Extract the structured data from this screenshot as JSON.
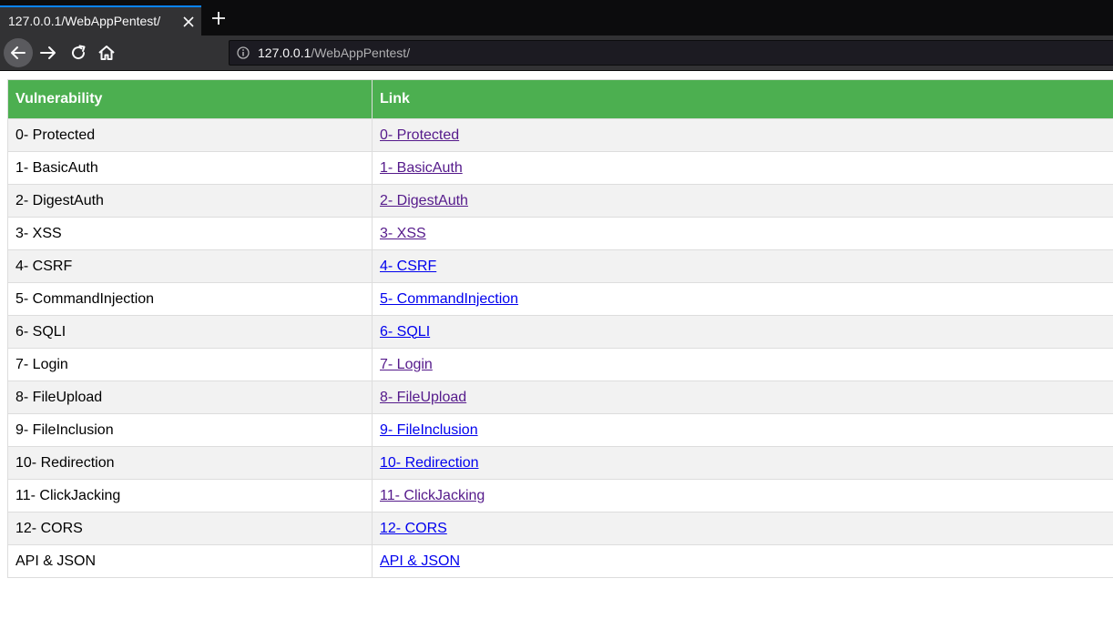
{
  "browser": {
    "tab_title": "127.0.0.1/WebAppPentest/",
    "url_host": "127.0.0.1",
    "url_path": "/WebAppPentest/"
  },
  "table": {
    "headers": [
      "Vulnerability",
      "Link"
    ],
    "rows": [
      {
        "name": "0- Protected",
        "link": "0- Protected",
        "visited": true
      },
      {
        "name": "1- BasicAuth",
        "link": "1- BasicAuth",
        "visited": true
      },
      {
        "name": "2- DigestAuth",
        "link": "2- DigestAuth",
        "visited": true
      },
      {
        "name": "3- XSS",
        "link": "3- XSS",
        "visited": true
      },
      {
        "name": "4- CSRF",
        "link": "4- CSRF",
        "visited": false
      },
      {
        "name": "5- CommandInjection",
        "link": "5- CommandInjection",
        "visited": false
      },
      {
        "name": "6- SQLI",
        "link": "6- SQLI",
        "visited": false
      },
      {
        "name": "7- Login",
        "link": "7- Login",
        "visited": true
      },
      {
        "name": "8- FileUpload",
        "link": "8- FileUpload",
        "visited": true
      },
      {
        "name": "9- FileInclusion",
        "link": "9- FileInclusion",
        "visited": false
      },
      {
        "name": "10- Redirection",
        "link": "10- Redirection",
        "visited": false
      },
      {
        "name": "11- ClickJacking",
        "link": "11- ClickJacking",
        "visited": true
      },
      {
        "name": "12- CORS",
        "link": "12- CORS",
        "visited": false
      },
      {
        "name": "API & JSON",
        "link": "API & JSON",
        "visited": false
      }
    ]
  },
  "colors": {
    "header_bg": "#4caf50",
    "link": "#0000ee",
    "link_visited": "#551a8b",
    "row_alt": "#f2f2f2"
  }
}
